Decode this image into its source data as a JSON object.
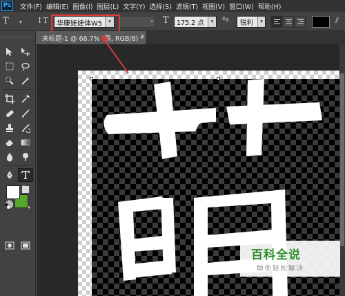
{
  "app": {
    "logo_text": "Ps"
  },
  "menu": [
    "文件(F)",
    "编辑(E)",
    "图像(I)",
    "图层(L)",
    "文字(Y)",
    "选择(S)",
    "滤镜(T)",
    "视图(V)",
    "窗口(W)",
    "帮助(H)"
  ],
  "options": {
    "tool_preset_glyph": "T",
    "orientation_glyph": "↕T",
    "font_family": "华康娃娃体W5",
    "font_style": "",
    "size_glyph": "T",
    "font_size": "175.2 点",
    "aa_glyph": "ªa",
    "antialias": "锐利",
    "dropdown_glyph": "▾",
    "text_color": "#000000",
    "warp_glyph": "⫽"
  },
  "document": {
    "tab_label": "未标题-1 @ 66.7% (萌, RGB/8) *",
    "close_glyph": "×"
  },
  "tools": {
    "foreground_color": "#ffffff",
    "background_color": "#55a82a"
  },
  "colors": {
    "highlight_red": "#e23b3b",
    "menu_bg": "#323232",
    "panel_bg": "#424242"
  },
  "watermark": {
    "title": "百科全说",
    "subtitle": "助你轻松解决"
  }
}
